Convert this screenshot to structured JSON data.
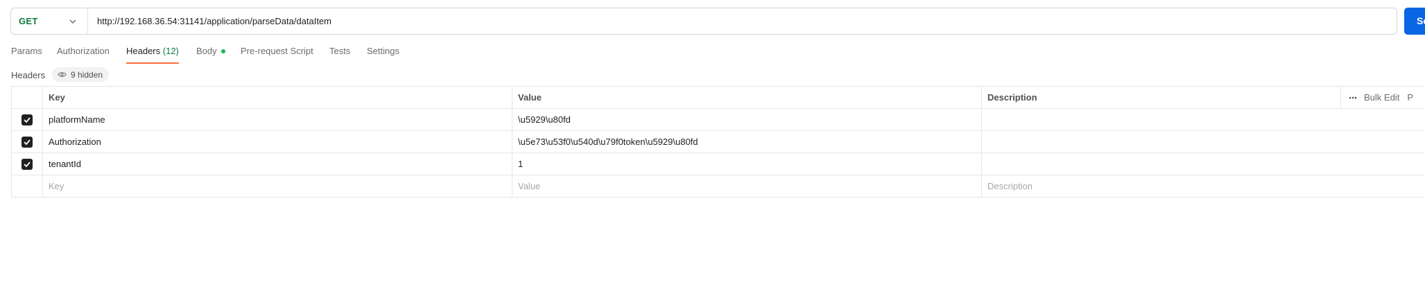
{
  "request": {
    "method": "GET",
    "url": "http://192.168.36.54:31141/application/parseData/dataItem",
    "send_label": "Se"
  },
  "tabs": [
    {
      "label": "Params"
    },
    {
      "label": "Authorization"
    },
    {
      "label": "Headers",
      "count": "(12)",
      "active": true
    },
    {
      "label": "Body",
      "dot": true
    },
    {
      "label": "Pre-request Script"
    },
    {
      "label": "Tests"
    },
    {
      "label": "Settings"
    }
  ],
  "headers_section": {
    "title": "Headers",
    "hidden_label": "9 hidden",
    "hidden_icon": "eye-icon"
  },
  "table": {
    "columns": {
      "key": "Key",
      "value": "Value",
      "description": "Description"
    },
    "actions": {
      "more_icon": "more-horizontal-icon",
      "bulk_edit": "Bulk Edit",
      "presets": "P"
    },
    "rows": [
      {
        "key": "platformName",
        "value": "\\u5929\\u80fd",
        "description": "",
        "checked": true
      },
      {
        "key": "Authorization",
        "value": "\\u5e73\\u53f0\\u540d\\u79f0token\\u5929\\u80fd",
        "description": "",
        "checked": true
      },
      {
        "key": "tenantId",
        "value": "1",
        "description": "",
        "checked": true
      }
    ],
    "placeholders": {
      "key": "Key",
      "value": "Value",
      "description": "Description"
    }
  },
  "colors": {
    "accent": "#ff6c37",
    "method_get": "#0b7a3e",
    "send": "#0a66e4",
    "body_dot": "#0cbb52"
  }
}
